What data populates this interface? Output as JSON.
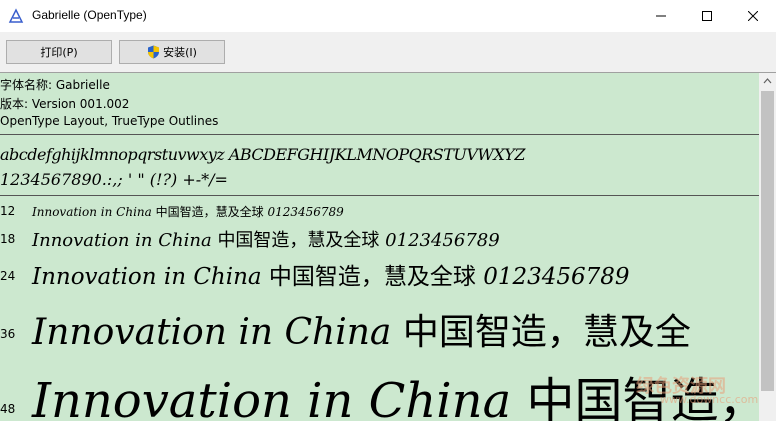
{
  "window": {
    "title": "Gabrielle (OpenType)",
    "icon": "font-viewer-icon"
  },
  "toolbar": {
    "print_label": "打印(P)",
    "install_label": "安装(I)"
  },
  "info": {
    "font_name": "字体名称: Gabrielle",
    "version": "版本: Version 001.002",
    "outline": "OpenType Layout, TrueType Outlines"
  },
  "charset": {
    "line1": "abcdefghijklmnopqrstuvwxyz ABCDEFGHIJKLMNOPQRSTUVWXYZ",
    "line2": "1234567890.:,; ' \" (!?) +-*/="
  },
  "samples": [
    {
      "size": "12",
      "latin": "Innovation in China",
      "cjk": "中国智造，慧及全球",
      "digits": "0123456789"
    },
    {
      "size": "18",
      "latin": "Innovation in China",
      "cjk": "中国智造，慧及全球",
      "digits": "0123456789"
    },
    {
      "size": "24",
      "latin": "Innovation in China",
      "cjk": "中国智造，慧及全球",
      "digits": "0123456789"
    },
    {
      "size": "36",
      "latin": "Innovation in China",
      "cjk": "中国智造，慧及全",
      "digits": ""
    },
    {
      "size": "48",
      "latin": "Innovation in China",
      "cjk": "中国智造，",
      "digits": ""
    }
  ],
  "watermark": {
    "line1": "绿色资源网",
    "line2": "www.downcc.com"
  }
}
